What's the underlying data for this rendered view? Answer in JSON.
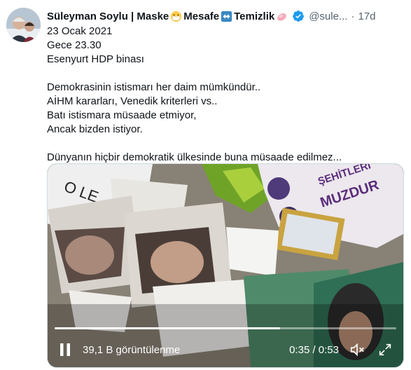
{
  "author": {
    "name_part1": "Süleyman Soylu | Maske",
    "name_part2": "Mesafe",
    "name_part3": "Temizlik",
    "handle": "@sule...",
    "separator": "·",
    "time_ago": "17d"
  },
  "tweet_lines": [
    "23 Ocak 2021",
    "Gece 23.30",
    "Esenyurt HDP binası",
    "",
    "Demokrasinin istismarı her daim mümkündür..",
    "AİHM kararları, Venedik kriterleri vs..",
    "Batı istismara müsaade etmiyor,",
    "Ancak bizden istiyor.",
    "",
    "Dünyanın hiçbir demokratik ülkesinde buna müsaade edilmez..."
  ],
  "video": {
    "views": "39,1 B görüntülenme",
    "time": "0:35 / 0:53",
    "progress": 0.66,
    "banner_text_1": "ŞEHİTLERİ",
    "banner_text_2": "MUZDUR"
  },
  "icons": {
    "mask_emoji": "face-with-mask",
    "arrow_emoji": "left-right-arrow",
    "soap_emoji": "soap",
    "verified": "verified-badge",
    "pause": "pause-icon",
    "mute": "speaker-muted-icon",
    "fullscreen": "fullscreen-icon"
  },
  "colors": {
    "accent": "#1d9bf0",
    "text": "#0f1419",
    "muted": "#536471"
  }
}
